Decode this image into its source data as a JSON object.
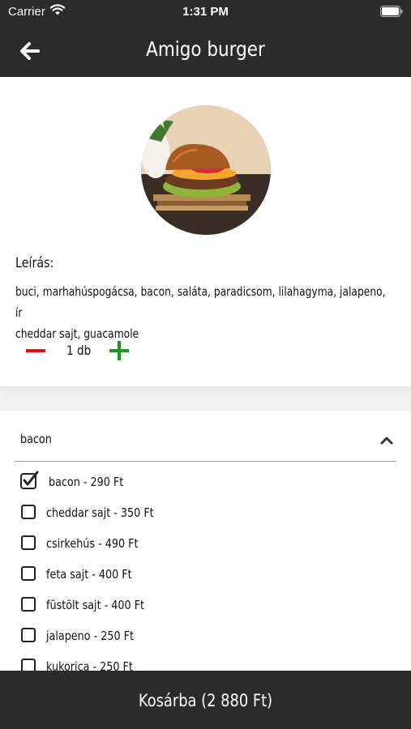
{
  "status_bar": {
    "carrier": "Carrier",
    "time": "1:31 PM",
    "wifi_icon": "wifi-icon",
    "battery_icon": "battery-icon"
  },
  "header": {
    "title": "Amigo burger",
    "back_icon": "arrow-left-icon",
    "background": "#2b2b2b"
  },
  "product": {
    "image": "burger-photo",
    "description_heading": "Leírás:",
    "description_line1": "buci, marhahúspogácsa, bacon, saláta, paradicsom, lilahagyma, jalapeno, ír",
    "description_line2": "cheddar sajt, guacamole",
    "quantity": "1 db",
    "minus_color": "#e01010",
    "plus_color": "#1a9a1a"
  },
  "options": {
    "group_title": "bacon",
    "expanded": true,
    "items": [
      {
        "label": "bacon - 290 Ft",
        "checked": true
      },
      {
        "label": "cheddar sajt - 350 Ft",
        "checked": false
      },
      {
        "label": "csirkehús - 490 Ft",
        "checked": false
      },
      {
        "label": "feta sajt - 400 Ft",
        "checked": false
      },
      {
        "label": "füstölt sajt - 400 Ft",
        "checked": false
      },
      {
        "label": "jalapeno - 250 Ft",
        "checked": false
      },
      {
        "label": "kukorica - 250 Ft",
        "checked": false
      }
    ]
  },
  "cart": {
    "label": "Kosárba (2 880 Ft)"
  }
}
